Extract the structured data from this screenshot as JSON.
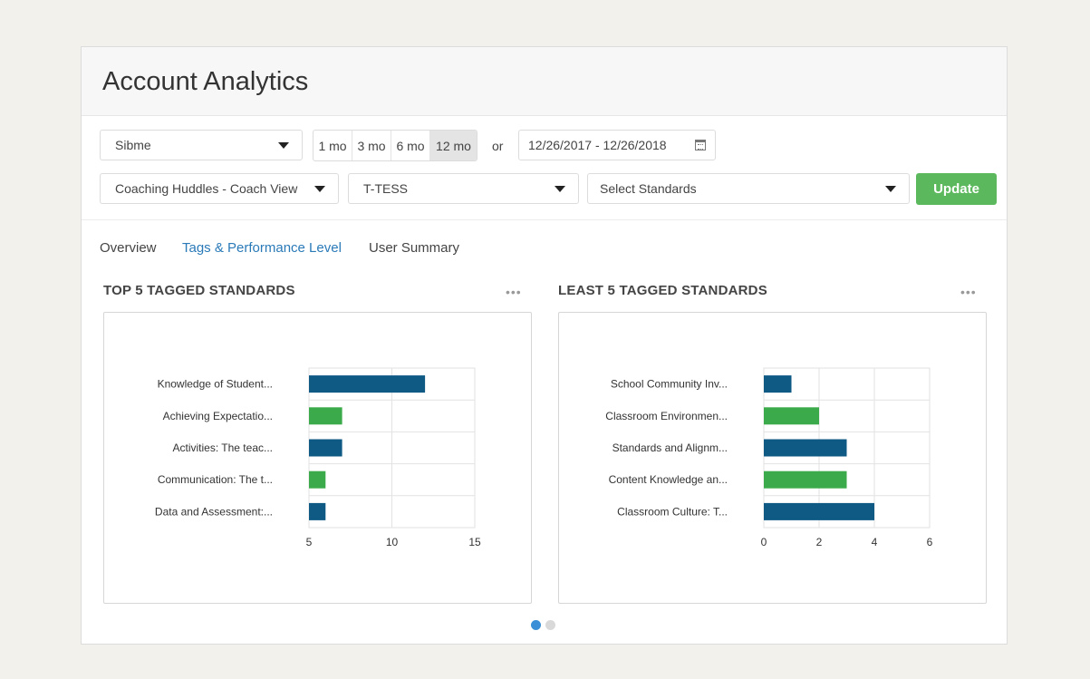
{
  "header": {
    "title": "Account Analytics"
  },
  "filters": {
    "account": "Sibme",
    "ranges": [
      "1 mo",
      "3 mo",
      "6 mo",
      "12 mo"
    ],
    "active_range": "12 mo",
    "or_label": "or",
    "date_range": "12/26/2017 - 12/26/2018",
    "huddle_type": "Coaching Huddles - Coach View",
    "framework": "T-TESS",
    "standards": "Select Standards",
    "update_label": "Update"
  },
  "tabs": [
    "Overview",
    "Tags & Performance Level",
    "User Summary"
  ],
  "active_tab": "Tags & Performance Level",
  "sections": {
    "top_title": "TOP 5 TAGGED STANDARDS",
    "least_title": "LEAST 5 TAGGED STANDARDS",
    "menu_dots": "•••"
  },
  "colors": {
    "blue": "#0f5a85",
    "green": "#3aaa4a",
    "update": "#5cb85c",
    "tab_active": "#2a7ab8"
  },
  "chart_data": [
    {
      "type": "bar",
      "orientation": "horizontal",
      "title": "TOP 5 TAGGED STANDARDS",
      "categories": [
        "Knowledge of Student...",
        "Achieving Expectatio...",
        "Activities: The teac...",
        "Communication: The t...",
        "Data and Assessment:..."
      ],
      "values": [
        12,
        7,
        7,
        6,
        6
      ],
      "bar_colors": [
        "#0f5a85",
        "#3aaa4a",
        "#0f5a85",
        "#3aaa4a",
        "#0f5a85"
      ],
      "xlim": [
        5,
        15
      ],
      "xticks": [
        5,
        10,
        15
      ],
      "grid": true
    },
    {
      "type": "bar",
      "orientation": "horizontal",
      "title": "LEAST 5 TAGGED STANDARDS",
      "categories": [
        "School Community Inv...",
        "Classroom Environmen...",
        "Standards and Alignm...",
        "Content Knowledge an...",
        "Classroom Culture: T..."
      ],
      "values": [
        1,
        2,
        3,
        3,
        4
      ],
      "bar_colors": [
        "#0f5a85",
        "#3aaa4a",
        "#0f5a85",
        "#3aaa4a",
        "#0f5a85"
      ],
      "xlim": [
        0,
        6
      ],
      "xticks": [
        0,
        2,
        4,
        6
      ],
      "grid": true
    }
  ],
  "pager": {
    "count": 2,
    "active": 0
  }
}
